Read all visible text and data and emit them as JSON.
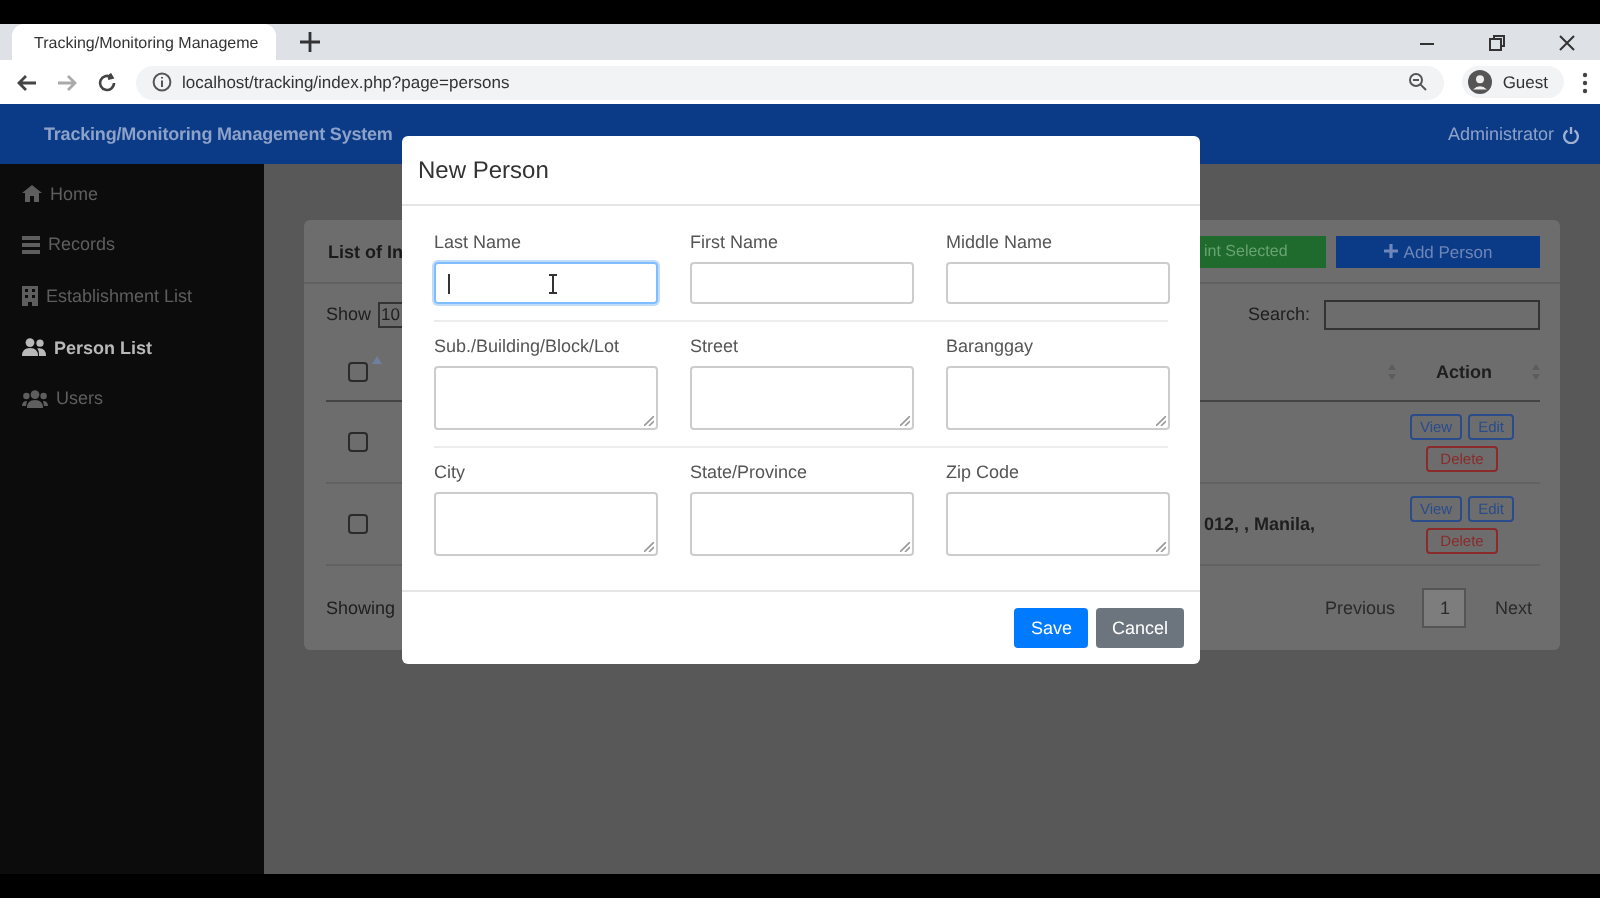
{
  "browser": {
    "tab_title": "Tracking/Monitoring Manageme",
    "url": "localhost/tracking/index.php?page=persons",
    "profile": "Guest"
  },
  "header": {
    "title": "Tracking/Monitoring Management System",
    "user": "Administrator"
  },
  "sidebar": {
    "items": [
      {
        "label": "Home",
        "kind": "home",
        "selected": false
      },
      {
        "label": "Records",
        "kind": "records",
        "selected": false
      },
      {
        "label": "Establishment List",
        "kind": "establishments",
        "selected": false
      },
      {
        "label": "Person List",
        "kind": "persons",
        "selected": true
      },
      {
        "label": "Users",
        "kind": "users",
        "selected": false
      }
    ]
  },
  "card": {
    "title": "List of In",
    "print_button": "int Selected",
    "add_button": "Add Person",
    "show_label": "Show",
    "page_size": "10",
    "search_label": "Search:",
    "select_all_checked": false,
    "action_header": "Action",
    "rows": [
      {
        "checked": false,
        "address": "",
        "actions": [
          "View",
          "Edit",
          "Delete"
        ]
      },
      {
        "checked": false,
        "address": "012, , Manila,",
        "actions": [
          "View",
          "Edit",
          "Delete"
        ]
      }
    ],
    "footer": "Showing",
    "pagination": [
      {
        "label": "Previous",
        "selected": false
      },
      {
        "label": "1",
        "selected": true
      },
      {
        "label": "Next",
        "selected": false
      }
    ]
  },
  "modal": {
    "title": "New Person",
    "sections": [
      {
        "fields": [
          {
            "label": "Last Name",
            "kind": "input",
            "focused": true
          },
          {
            "label": "First Name",
            "kind": "input",
            "focused": false
          },
          {
            "label": "Middle Name",
            "kind": "input",
            "focused": false
          }
        ]
      },
      {
        "fields": [
          {
            "label": "Sub./Building/Block/Lot",
            "kind": "textarea",
            "focused": false
          },
          {
            "label": "Street",
            "kind": "textarea",
            "focused": false
          },
          {
            "label": "Baranggay",
            "kind": "textarea",
            "focused": false
          }
        ]
      },
      {
        "fields": [
          {
            "label": "City",
            "kind": "textarea",
            "focused": false
          },
          {
            "label": "State/Province",
            "kind": "textarea",
            "focused": false
          },
          {
            "label": "Zip Code",
            "kind": "textarea",
            "focused": false
          }
        ]
      }
    ],
    "buttons": [
      {
        "label": "Save",
        "kind": "primary"
      },
      {
        "label": "Cancel",
        "kind": "secondary"
      }
    ]
  }
}
